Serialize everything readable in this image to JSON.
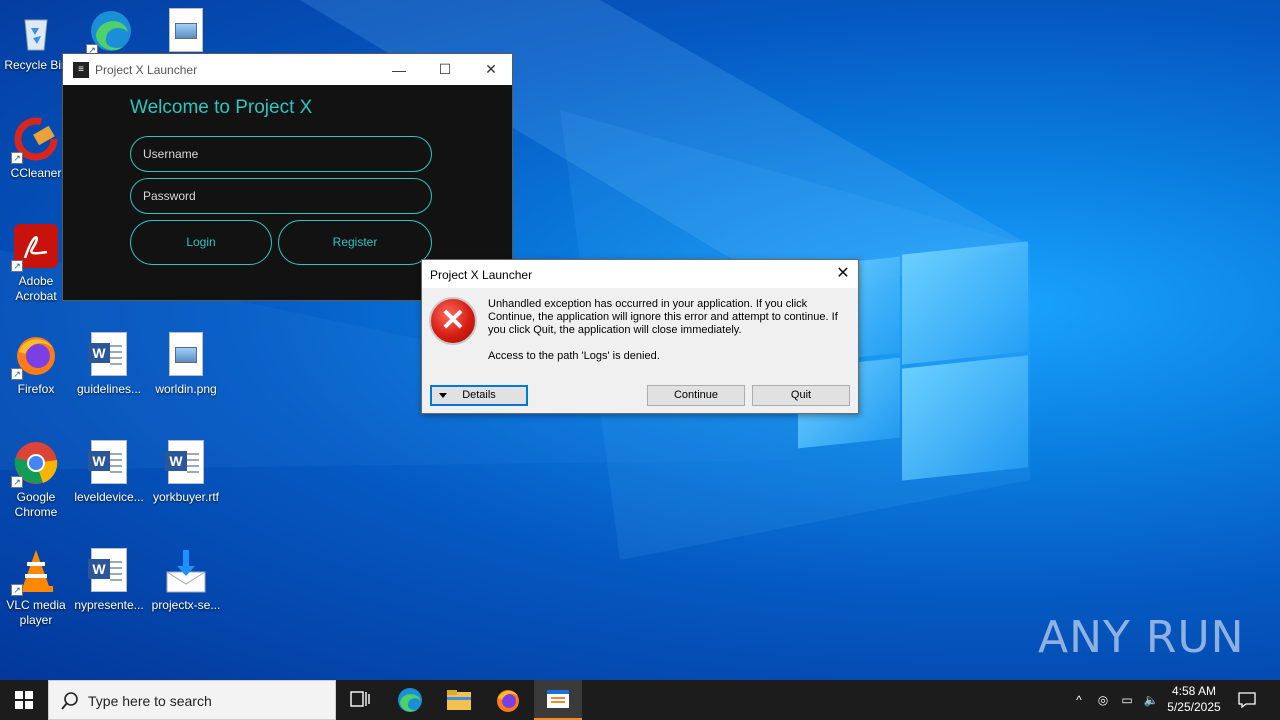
{
  "desktop": {
    "icons": [
      {
        "label": "Recycle Bin",
        "icon": "recycle-bin-icon"
      },
      {
        "label": "CCleaner",
        "icon": "ccleaner-icon"
      },
      {
        "label": "Adobe Acrobat",
        "icon": "acrobat-icon"
      },
      {
        "label": "Firefox",
        "icon": "firefox-icon"
      },
      {
        "label": "Google Chrome",
        "icon": "chrome-icon"
      },
      {
        "label": "VLC media player",
        "icon": "vlc-icon"
      },
      {
        "label": "guidelines...",
        "icon": "word-doc-icon"
      },
      {
        "label": "leveldevice...",
        "icon": "word-doc-icon"
      },
      {
        "label": "nypresente...",
        "icon": "word-doc-icon"
      },
      {
        "label": "worldin.png",
        "icon": "image-file-icon"
      },
      {
        "label": "yorkbuyer.rtf",
        "icon": "word-doc-icon"
      },
      {
        "label": "projectx-se...",
        "icon": "installer-icon"
      }
    ]
  },
  "launcher": {
    "title": "Project X Launcher",
    "welcome": "Welcome to Project X",
    "username_placeholder": "Username",
    "password_placeholder": "Password",
    "login_label": "Login",
    "register_label": "Register",
    "accent": "#2ec4c0"
  },
  "dialog": {
    "title": "Project X Launcher",
    "message_lines": [
      "Unhandled exception has occurred in your application. If you click",
      "Continue, the application will ignore this error and attempt to continue. If",
      "you click Quit, the application will close immediately."
    ],
    "detail": "Access to the path 'Logs' is denied.",
    "details_label": "Details",
    "continue_label": "Continue",
    "quit_label": "Quit"
  },
  "watermark": "ANY RUN",
  "taskbar": {
    "search_placeholder": "Type here to search",
    "time": "4:58 AM",
    "date": "5/25/2025"
  }
}
